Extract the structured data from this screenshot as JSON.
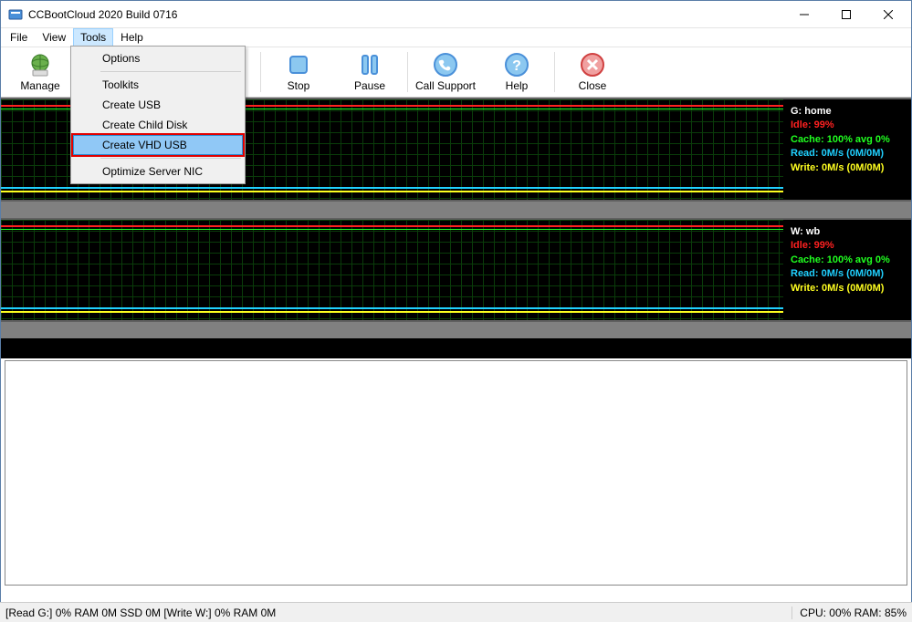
{
  "window": {
    "title": "CCBootCloud 2020 Build 0716"
  },
  "menubar": {
    "items": [
      "File",
      "View",
      "Tools",
      "Help"
    ],
    "active_index": 2
  },
  "dropdown": {
    "items": [
      {
        "label": "Options"
      },
      {
        "sep": true
      },
      {
        "label": "Toolkits"
      },
      {
        "label": "Create USB"
      },
      {
        "label": "Create Child Disk"
      },
      {
        "label": "Create VHD USB",
        "highlight": true
      },
      {
        "sep": true
      },
      {
        "label": "Optimize Server NIC"
      }
    ]
  },
  "toolbar": {
    "buttons": [
      {
        "label": "Manage",
        "icon": "globe"
      },
      {
        "label": "Stop",
        "icon": "stop"
      },
      {
        "label": "Pause",
        "icon": "pause"
      },
      {
        "label": "Call Support",
        "icon": "phone"
      },
      {
        "label": "Help",
        "icon": "help"
      },
      {
        "label": "Close",
        "icon": "close"
      }
    ]
  },
  "graphs": [
    {
      "title": "G: home",
      "idle": "Idle: 99%",
      "cache": "Cache: 100% avg 0%",
      "read": "Read: 0M/s (0M/0M)",
      "write": "Write: 0M/s (0M/0M)"
    },
    {
      "title": "W: wb",
      "idle": "Idle: 99%",
      "cache": "Cache: 100% avg 0%",
      "read": "Read: 0M/s (0M/0M)",
      "write": "Write: 0M/s (0M/0M)"
    }
  ],
  "statusbar": {
    "left": "[Read G:] 0% RAM 0M SSD 0M [Write W:] 0% RAM 0M",
    "right": "CPU: 00% RAM: 85%"
  }
}
